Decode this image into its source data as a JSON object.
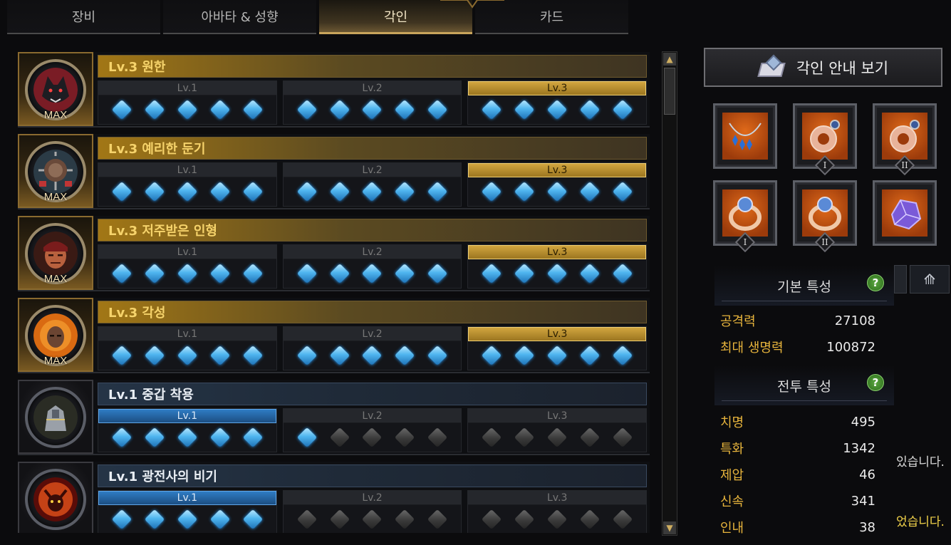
{
  "tabs": [
    "장비",
    "아바타 & 성향",
    "각인",
    "카드"
  ],
  "active_tab": 2,
  "engravings": [
    {
      "title": "Lv.3 원한",
      "max_label": "MAX",
      "state": "max",
      "levels": [
        "Lv.1",
        "Lv.2",
        "Lv.3"
      ],
      "active_level": 2,
      "gems_on": 15,
      "face": "wolf"
    },
    {
      "title": "Lv.3 예리한 둔기",
      "max_label": "MAX",
      "state": "max",
      "levels": [
        "Lv.1",
        "Lv.2",
        "Lv.3"
      ],
      "active_level": 2,
      "gems_on": 15,
      "face": "mace"
    },
    {
      "title": "Lv.3 저주받은 인형",
      "max_label": "MAX",
      "state": "max",
      "levels": [
        "Lv.1",
        "Lv.2",
        "Lv.3"
      ],
      "active_level": 2,
      "gems_on": 15,
      "face": "cursed"
    },
    {
      "title": "Lv.3 각성",
      "max_label": "MAX",
      "state": "max",
      "levels": [
        "Lv.1",
        "Lv.2",
        "Lv.3"
      ],
      "active_level": 2,
      "gems_on": 15,
      "face": "awaken"
    },
    {
      "title": "Lv.1 중갑 착용",
      "max_label": "",
      "state": "low",
      "levels": [
        "Lv.1",
        "Lv.2",
        "Lv.3"
      ],
      "active_level": 0,
      "gems_on": 6,
      "face": "armor"
    },
    {
      "title": "Lv.1 광전사의 비기",
      "max_label": "",
      "state": "low",
      "levels": [
        "Lv.1",
        "Lv.2",
        "Lv.3"
      ],
      "active_level": 0,
      "gems_on": 5,
      "face": "berserk"
    }
  ],
  "guide_button": "각인 안내 보기",
  "accessories": [
    {
      "name": "necklace",
      "tier": ""
    },
    {
      "name": "earring",
      "tier": "I"
    },
    {
      "name": "earring",
      "tier": "II"
    },
    {
      "name": "ring",
      "tier": "I"
    },
    {
      "name": "ring",
      "tier": "II"
    },
    {
      "name": "ability-stone",
      "tier": ""
    }
  ],
  "basic_stats": {
    "header": "기본 특성",
    "help": "?",
    "items": [
      {
        "label": "공격력",
        "value": "27108"
      },
      {
        "label": "최대 생명력",
        "value": "100872"
      }
    ]
  },
  "combat_stats": {
    "header": "전투 특성",
    "help": "?",
    "items": [
      {
        "label": "치명",
        "value": "495"
      },
      {
        "label": "특화",
        "value": "1342"
      },
      {
        "label": "제압",
        "value": "46"
      },
      {
        "label": "신속",
        "value": "341"
      },
      {
        "label": "인내",
        "value": "38"
      }
    ]
  },
  "peek": {
    "text1": "있습니다.",
    "text2": "었습니다."
  },
  "colors": {
    "gold": "#f6d36b",
    "gem_blue": "#4fb5ef",
    "stat_key": "#e7b43c"
  }
}
